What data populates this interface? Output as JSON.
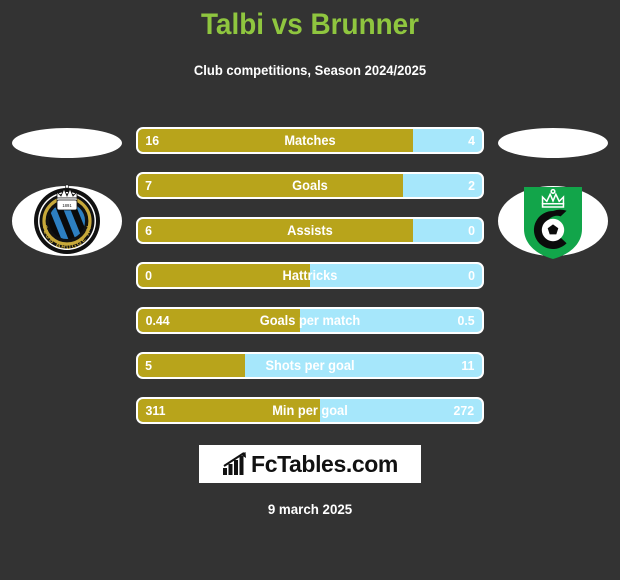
{
  "header": {
    "title": "Talbi vs Brunner",
    "subtitle": "Club competitions, Season 2024/2025",
    "title_color": "#8FC63F",
    "subtitle_color": "#ffffff"
  },
  "theme": {
    "background": "#333333",
    "home_color": "#B8A41B",
    "away_color": "#A6E7FB",
    "border_color": "#ffffff"
  },
  "logos": {
    "home_top_placeholder": "blank-ellipse",
    "away_top_placeholder": "blank-ellipse",
    "home_club": "Club Brugge KV",
    "home_club_crest_text": "CLUB BRUGGE KV",
    "away_club": "Cercle Brugge"
  },
  "chart_data": {
    "type": "bar",
    "title": "Talbi vs Brunner",
    "subtitle": "Club competitions, Season 2024/2025",
    "orientation": "horizontal-diverging",
    "series": [
      {
        "name": "Talbi",
        "color": "#B8A41B"
      },
      {
        "name": "Brunner",
        "color": "#A6E7FB"
      }
    ],
    "categories": [
      "Matches",
      "Goals",
      "Assists",
      "Hattricks",
      "Goals per match",
      "Shots per goal",
      "Min per goal"
    ],
    "rows": [
      {
        "label": "Matches",
        "home": "16",
        "away": "4",
        "home_pct": 80
      },
      {
        "label": "Goals",
        "home": "7",
        "away": "2",
        "home_pct": 77
      },
      {
        "label": "Assists",
        "home": "6",
        "away": "0",
        "home_pct": 80
      },
      {
        "label": "Hattricks",
        "home": "0",
        "away": "0",
        "home_pct": 50
      },
      {
        "label": "Goals per match",
        "home": "0.44",
        "away": "0.5",
        "home_pct": 47
      },
      {
        "label": "Shots per goal",
        "home": "5",
        "away": "11",
        "home_pct": 31
      },
      {
        "label": "Min per goal",
        "home": "311",
        "away": "272",
        "home_pct": 53
      }
    ]
  },
  "footer": {
    "brand": "FcTables.com",
    "brand_icon": "bar-chart-arrow-icon",
    "date": "9 march 2025"
  }
}
